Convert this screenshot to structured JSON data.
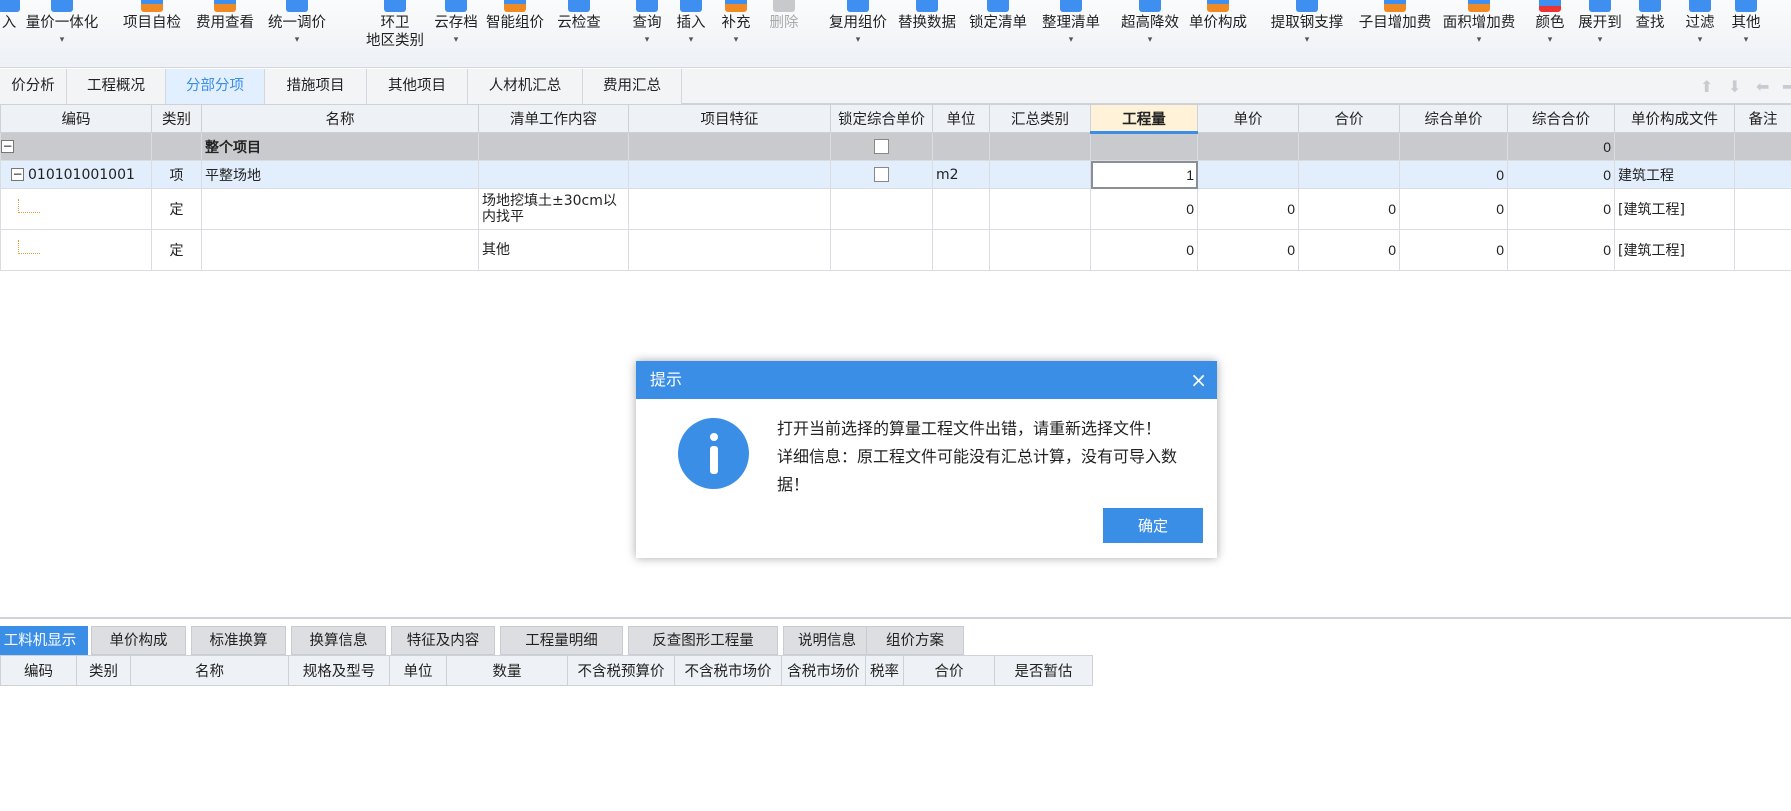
{
  "toolbar": {
    "items": [
      {
        "label": "入"
      },
      {
        "label": "量价一体化",
        "dropdown": "▾"
      },
      {
        "label": "项目自检"
      },
      {
        "label": "费用查看"
      },
      {
        "label": "统一调价",
        "dropdown": "▾"
      },
      {
        "label": "环卫",
        "label2": "地区类别"
      },
      {
        "label": "云存档",
        "dropdown": "▾"
      },
      {
        "label": "智能组价"
      },
      {
        "label": "云检查"
      },
      {
        "label": "查询",
        "dropdown": "▾"
      },
      {
        "label": "插入",
        "dropdown": "▾"
      },
      {
        "label": "补充",
        "dropdown": "▾"
      },
      {
        "label": "删除"
      },
      {
        "label": "复用组价",
        "dropdown": "▾"
      },
      {
        "label": "替换数据"
      },
      {
        "label": "锁定清单"
      },
      {
        "label": "整理清单",
        "dropdown": "▾"
      },
      {
        "label": "超高降效",
        "dropdown": "▾"
      },
      {
        "label": "单价构成"
      },
      {
        "label": "提取钢支撑",
        "dropdown": "▾"
      },
      {
        "label": "子目增加费"
      },
      {
        "label": "面积增加费",
        "dropdown": "▾"
      },
      {
        "label": "颜色",
        "dropdown": "▾"
      },
      {
        "label": "展开到",
        "dropdown": "▾"
      },
      {
        "label": "查找"
      },
      {
        "label": "过滤",
        "dropdown": "▾"
      },
      {
        "label": "其他",
        "dropdown": "▾"
      }
    ]
  },
  "tabs": [
    "价分析",
    "工程概况",
    "分部分项",
    "措施项目",
    "其他项目",
    "人材机汇总",
    "费用汇总"
  ],
  "grid": {
    "headers": [
      "编码",
      "类别",
      "名称",
      "清单工作内容",
      "项目特征",
      "锁定综合单价",
      "单位",
      "汇总类别",
      "工程量",
      "单价",
      "合价",
      "综合单价",
      "综合合价",
      "单价构成文件",
      "备注"
    ],
    "rows": [
      {
        "code": "",
        "type": "",
        "name": "整个项目",
        "content": "",
        "feature": "",
        "unit": "",
        "summary": "",
        "qty": "",
        "price": "",
        "total": "",
        "uprice": "",
        "utotal": "0",
        "file": "",
        "toggle": "−"
      },
      {
        "code": "010101001001",
        "type": "项",
        "name": "平整场地",
        "content": "",
        "feature": "",
        "unit": "m2",
        "summary": "",
        "qty": "1",
        "price": "",
        "total": "",
        "uprice": "0",
        "utotal": "0",
        "file": "建筑工程",
        "toggle": "−"
      },
      {
        "code": "",
        "type": "定",
        "name": "",
        "content": "场地挖填土±30cm以内找平",
        "feature": "",
        "unit": "",
        "summary": "",
        "qty": "0",
        "price": "0",
        "total": "0",
        "uprice": "0",
        "utotal": "0",
        "file": "[建筑工程]"
      },
      {
        "code": "",
        "type": "定",
        "name": "",
        "content": "其他",
        "feature": "",
        "unit": "",
        "summary": "",
        "qty": "0",
        "price": "0",
        "total": "0",
        "uprice": "0",
        "utotal": "0",
        "file": "[建筑工程]"
      }
    ]
  },
  "bottom": {
    "tabs": [
      "工料机显示",
      "单价构成",
      "标准换算",
      "换算信息",
      "特征及内容",
      "工程量明细",
      "反查图形工程量",
      "说明信息",
      "组价方案"
    ],
    "headers": [
      "编码",
      "类别",
      "名称",
      "规格及型号",
      "单位",
      "数量",
      "不含税预算价",
      "不含税市场价",
      "含税市场价",
      "税率",
      "合价",
      "是否暂估"
    ]
  },
  "dialog": {
    "title": "提示",
    "close": "×",
    "message": "打开当前选择的算量工程文件出错，请重新选择文件！ 详细信息：原工程文件可能没有汇总计算，没有可导入数据！",
    "ok": "确定"
  },
  "colors": {
    "accent": "#3a8ee6",
    "active_tab_bg": "#e2efff"
  },
  "icons": [
    "info-icon",
    "close-icon",
    "toolbar-icon"
  ]
}
